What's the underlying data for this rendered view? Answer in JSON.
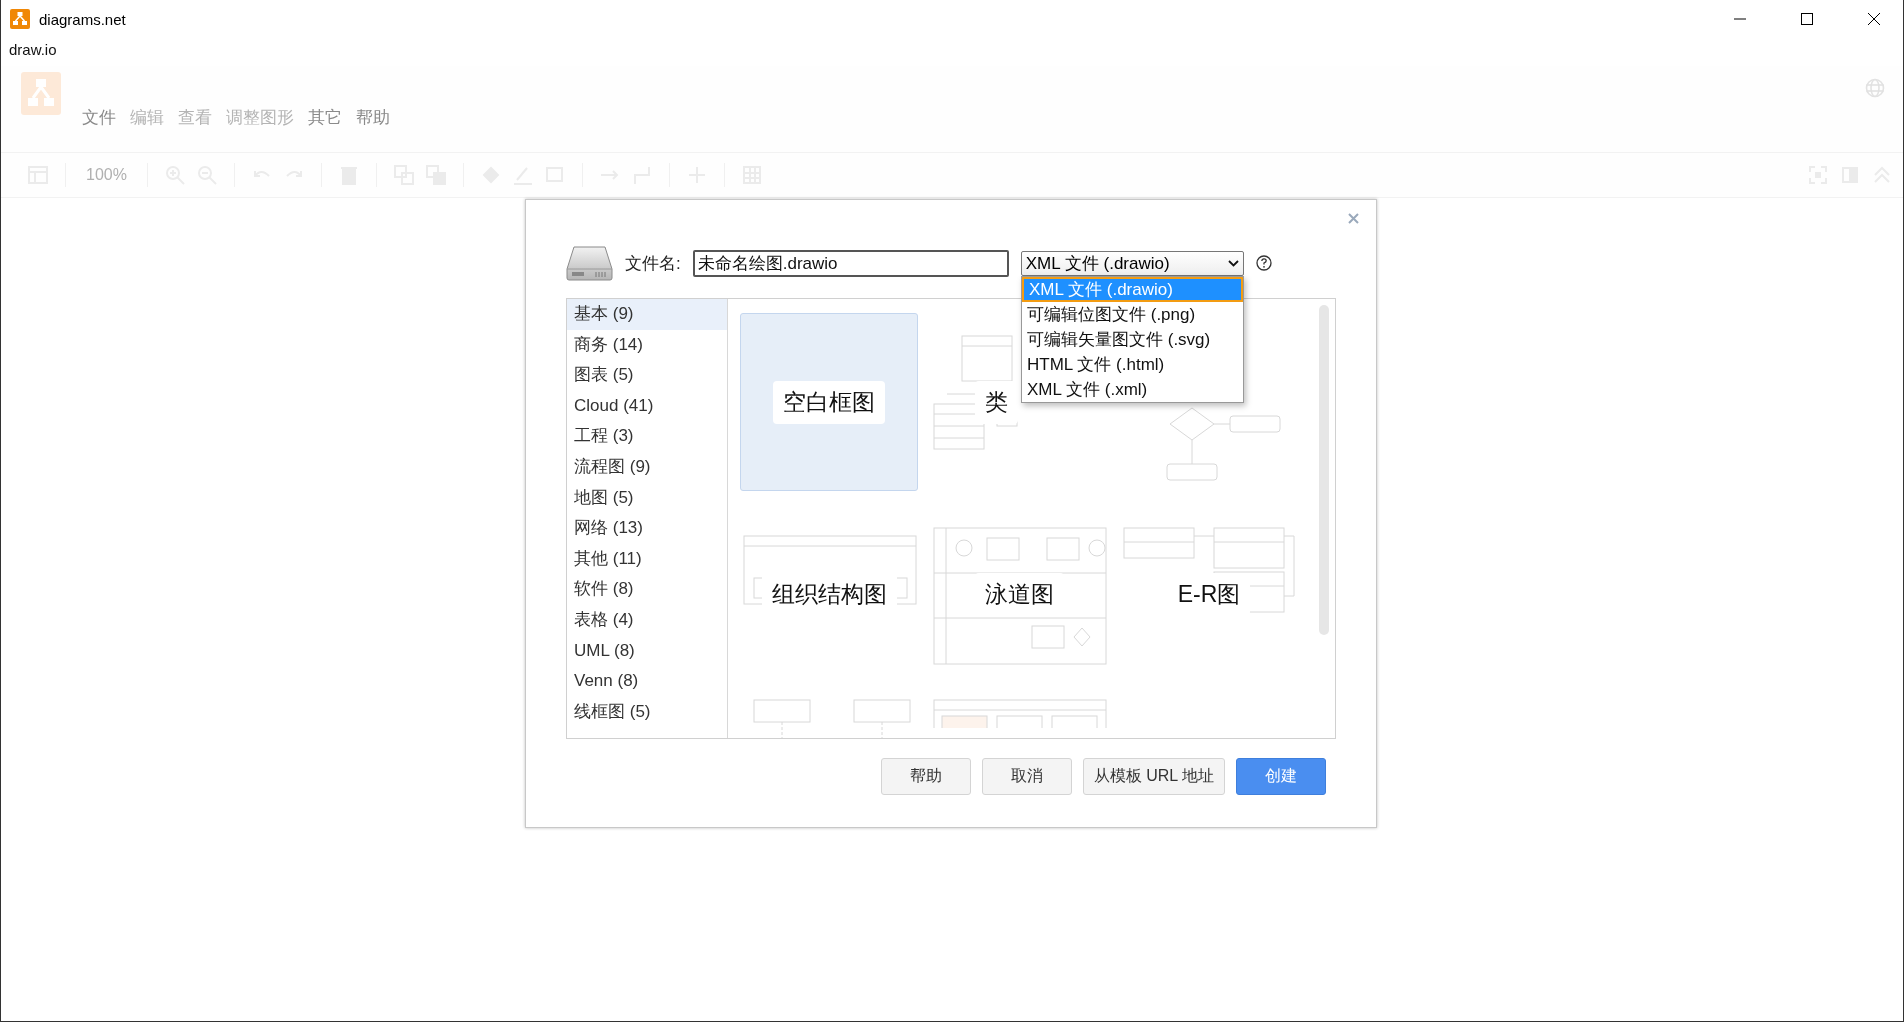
{
  "window": {
    "title": "diagrams.net",
    "subtitle": "draw.io"
  },
  "menu": [
    {
      "label": "文件",
      "disabled": false
    },
    {
      "label": "编辑",
      "disabled": true
    },
    {
      "label": "查看",
      "disabled": true
    },
    {
      "label": "调整图形",
      "disabled": true
    },
    {
      "label": "其它",
      "disabled": false
    },
    {
      "label": "帮助",
      "disabled": false
    }
  ],
  "toolbar": {
    "zoom": "100%"
  },
  "dialog": {
    "filename_label": "文件名:",
    "filename": "未命名绘图.drawio",
    "format": "XML 文件 (.drawio)",
    "format_options": [
      {
        "label": "XML 文件 (.drawio)",
        "selected": true
      },
      {
        "label": "可编辑位图文件 (.png)",
        "selected": false
      },
      {
        "label": "可编辑矢量图文件 (.svg)",
        "selected": false
      },
      {
        "label": "HTML 文件 (.html)",
        "selected": false
      },
      {
        "label": "XML 文件 (.xml)",
        "selected": false
      }
    ],
    "categories": [
      {
        "label": "基本 (9)",
        "selected": true
      },
      {
        "label": "商务 (14)",
        "selected": false
      },
      {
        "label": "图表 (5)",
        "selected": false
      },
      {
        "label": "Cloud (41)",
        "selected": false
      },
      {
        "label": "工程 (3)",
        "selected": false
      },
      {
        "label": "流程图 (9)",
        "selected": false
      },
      {
        "label": "地图 (5)",
        "selected": false
      },
      {
        "label": "网络 (13)",
        "selected": false
      },
      {
        "label": "其他 (11)",
        "selected": false
      },
      {
        "label": "软件 (8)",
        "selected": false
      },
      {
        "label": "表格 (4)",
        "selected": false
      },
      {
        "label": "UML (8)",
        "selected": false
      },
      {
        "label": "Venn (8)",
        "selected": false
      },
      {
        "label": "线框图 (5)",
        "selected": false
      }
    ],
    "templates": [
      {
        "label": "空白框图",
        "kind": "blank",
        "selected": true
      },
      {
        "label": "类",
        "kind": "class",
        "selected": false
      },
      {
        "kind": "flow",
        "selected": false
      },
      {
        "label": "组织结构图",
        "kind": "org",
        "selected": false
      },
      {
        "label": "泳道图",
        "kind": "swimlane",
        "selected": false
      },
      {
        "label": "E-R图",
        "kind": "er",
        "selected": false
      },
      {
        "kind": "sequence",
        "selected": false
      },
      {
        "kind": "wireframe",
        "selected": false
      }
    ],
    "buttons": [
      {
        "label": "帮助",
        "kind": "plain"
      },
      {
        "label": "取消",
        "kind": "plain"
      },
      {
        "label": "从模板 URL 地址",
        "kind": "plain"
      },
      {
        "label": "创建",
        "kind": "primary"
      }
    ]
  }
}
